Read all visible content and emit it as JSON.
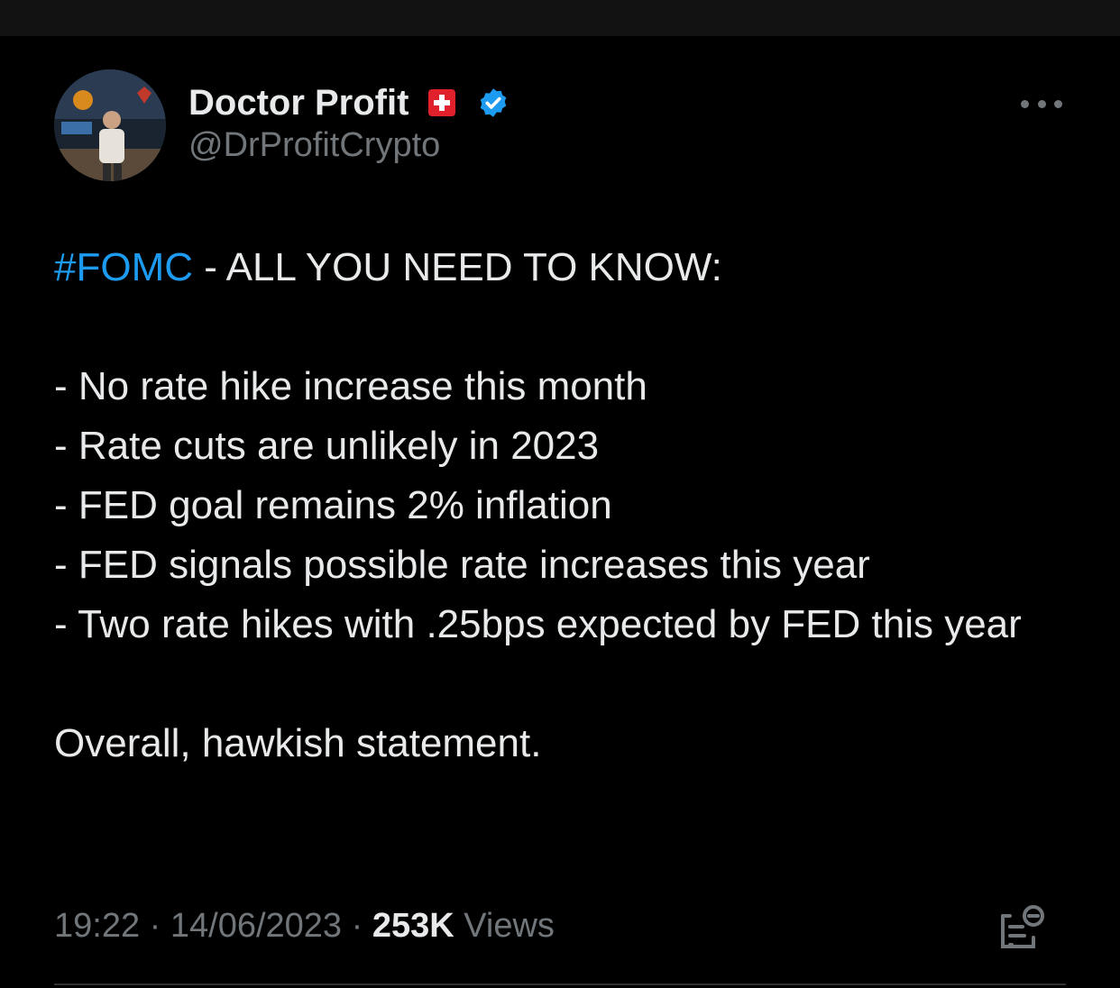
{
  "author": {
    "display_name": "Doctor Profit",
    "handle": "@DrProfitCrypto",
    "flag_icon": "swiss-flag-icon",
    "verified_icon": "verified-badge-icon",
    "verified_color": "#1d9bf0"
  },
  "tweet": {
    "hashtag": "#FOMC",
    "headline_rest": " - ALL YOU NEED TO KNOW:",
    "bullets": [
      "- No rate hike increase this month",
      "- Rate cuts are unlikely in 2023",
      "- FED goal remains 2% inflation",
      "- FED signals possible rate increases this year",
      "- Two rate hikes with .25bps expected by FED this year"
    ],
    "closing": "Overall, hawkish statement."
  },
  "meta": {
    "time": "19:22",
    "separator1": " · ",
    "date": "14/06/2023",
    "separator2": " · ",
    "views_count": "253K",
    "views_label": " Views"
  },
  "colors": {
    "background": "#000000",
    "text": "#e7e9ea",
    "secondary": "#71767b",
    "accent": "#1d9bf0"
  }
}
